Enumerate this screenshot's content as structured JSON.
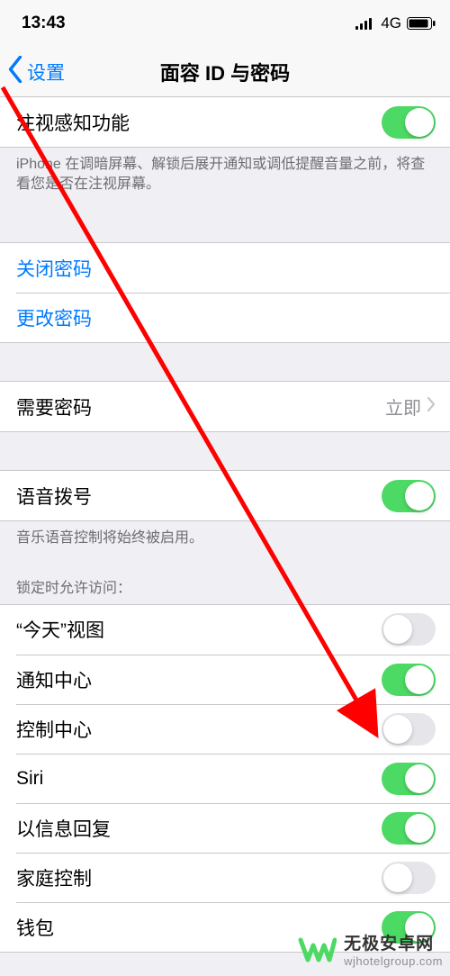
{
  "status": {
    "time": "13:43",
    "network": "4G"
  },
  "nav": {
    "back": "设置",
    "title": "面容 ID 与密码"
  },
  "attention": {
    "label": "注视感知功能",
    "on": true,
    "footer": "iPhone 在调暗屏幕、解锁后展开通知或调低提醒音量之前，将查看您是否在注视屏幕。"
  },
  "passcode": {
    "turn_off": "关闭密码",
    "change": "更改密码"
  },
  "require": {
    "label": "需要密码",
    "value": "立即"
  },
  "voice": {
    "label": "语音拨号",
    "on": true,
    "footer": "音乐语音控制将始终被启用。"
  },
  "lock_header": "锁定时允许访问：",
  "lock_items": [
    {
      "label": "“今天”视图",
      "on": false
    },
    {
      "label": "通知中心",
      "on": true
    },
    {
      "label": "控制中心",
      "on": false
    },
    {
      "label": "Siri",
      "on": true
    },
    {
      "label": "以信息回复",
      "on": true
    },
    {
      "label": "家庭控制",
      "on": false
    },
    {
      "label": "钱包",
      "on": true
    }
  ],
  "watermark": {
    "main": "无极安卓网",
    "sub": "wjhotelgroup.com"
  }
}
